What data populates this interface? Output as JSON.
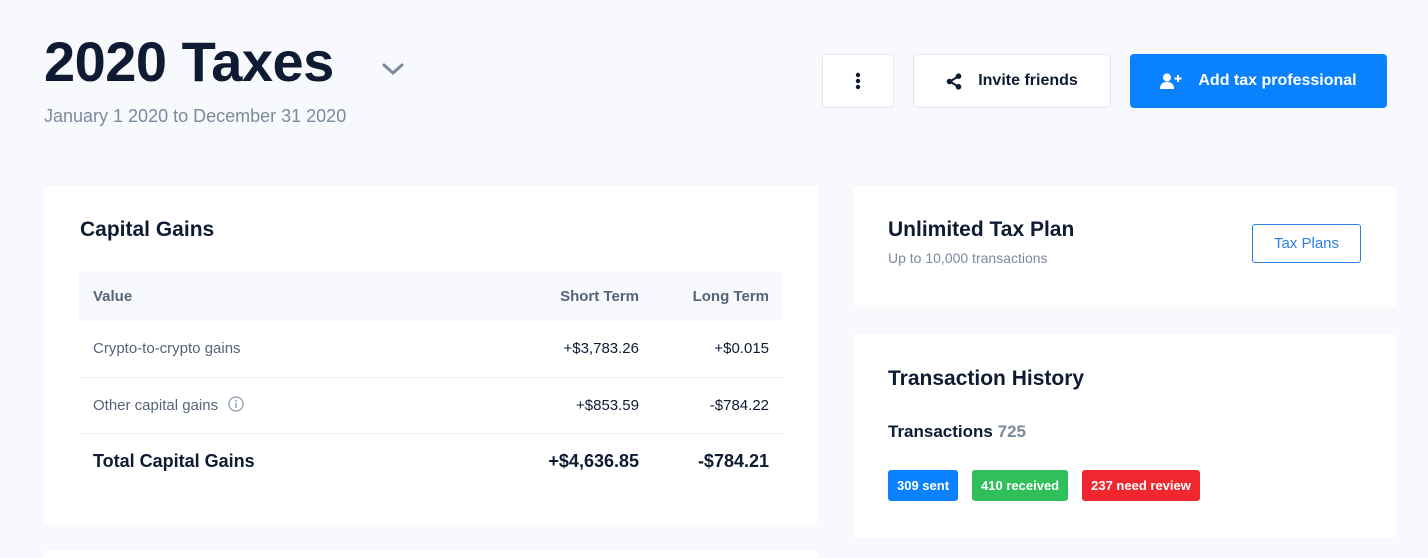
{
  "header": {
    "title": "2020 Taxes",
    "date_range": "January 1 2020 to December 31 2020",
    "invite_label": "Invite friends",
    "add_pro_label": "Add tax professional",
    "icons": [
      "chevron-down-icon",
      "more-vertical-icon",
      "share-icon",
      "add-user-icon"
    ]
  },
  "capital_gains": {
    "title": "Capital Gains",
    "columns": [
      "Value",
      "Short Term",
      "Long Term"
    ],
    "rows": [
      {
        "label": "Crypto-to-crypto gains",
        "short": "+$3,783.26",
        "long": "+$0.015"
      },
      {
        "label": "Other capital gains",
        "short": "+$853.59",
        "long": "-$784.22"
      }
    ],
    "total": {
      "label": "Total Capital Gains",
      "short": "+$4,636.85",
      "long": "-$784.21"
    }
  },
  "plan": {
    "title": "Unlimited Tax Plan",
    "subtitle": "Up to 10,000 transactions",
    "button_label": "Tax Plans"
  },
  "history": {
    "title": "Transaction History",
    "transactions_label": "Transactions",
    "transactions_count": "725",
    "badges": [
      {
        "label": "309 sent",
        "color": "#0a82ff"
      },
      {
        "label": "410 received",
        "color": "#2fbf5b"
      },
      {
        "label": "237 need review",
        "color": "#f0272f"
      }
    ]
  },
  "colors": {
    "accent": "#0a82ff",
    "background": "#f7f9fc",
    "text": "#0f1a33",
    "muted": "#7c8a9e"
  }
}
